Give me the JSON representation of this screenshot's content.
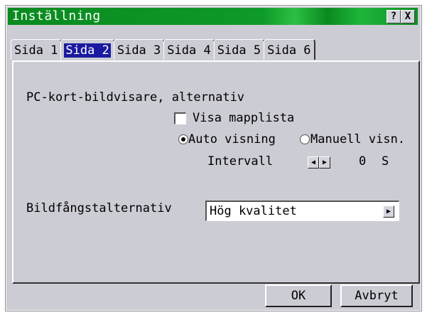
{
  "window": {
    "title": "Inställning",
    "help_label": "?",
    "close_label": "X"
  },
  "tabs": [
    {
      "label": "Sida 1",
      "active": false
    },
    {
      "label": "Sida 2",
      "active": true
    },
    {
      "label": "Sida 3",
      "active": false
    },
    {
      "label": "Sida 4",
      "active": false
    },
    {
      "label": "Sida 5",
      "active": false
    },
    {
      "label": "Sida 6",
      "active": false
    }
  ],
  "viewer": {
    "heading": "PC-kort-bildvisare, alternativ",
    "show_folder_list": {
      "label": "Visa mapplista",
      "checked": false
    },
    "auto_radio": {
      "label": "Auto visning",
      "selected": true
    },
    "manual_radio": {
      "label": "Manuell visn.",
      "selected": false
    },
    "interval": {
      "label": "Intervall",
      "value": "0",
      "unit": "S"
    }
  },
  "capture": {
    "label": "Bildfångstalternativ",
    "selected": "Hög kvalitet"
  },
  "buttons": {
    "ok": "OK",
    "cancel": "Avbryt"
  },
  "colors": {
    "titlebar": "#0a8a1f",
    "selection": "#1a1aa0",
    "background": "#ccccd4"
  }
}
